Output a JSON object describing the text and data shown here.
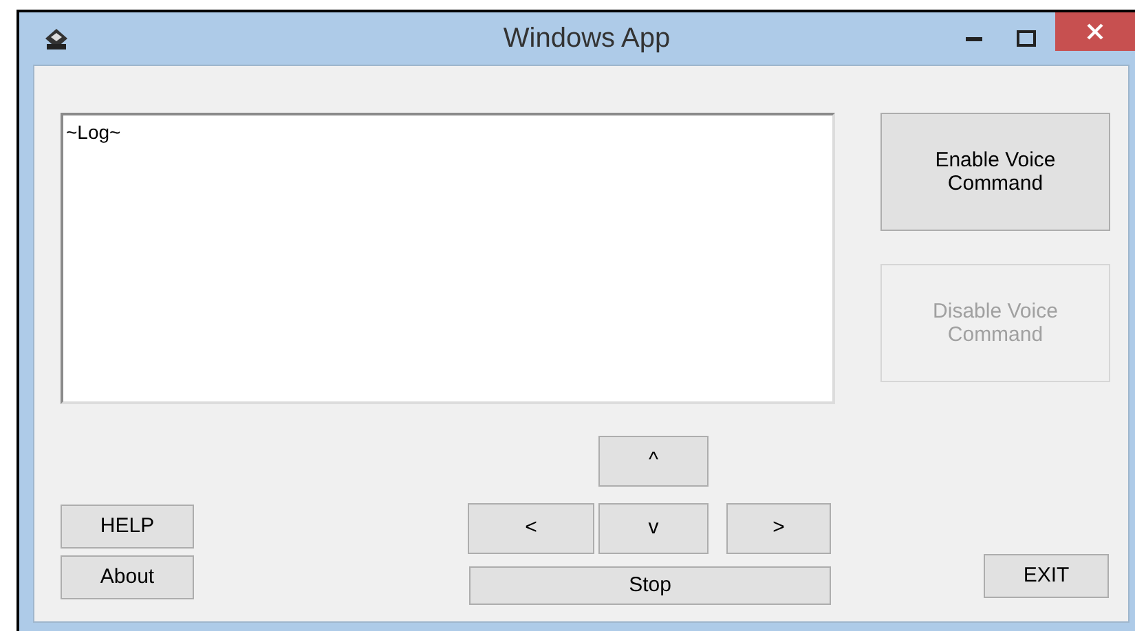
{
  "window": {
    "title": "Windows App"
  },
  "log": {
    "value": "~Log~"
  },
  "voice_buttons": [
    {
      "label": "Enable Voice Command",
      "disabled": false
    },
    {
      "label": "Disable Voice Command",
      "disabled": true
    }
  ],
  "help_buttons": [
    {
      "label": "HELP"
    },
    {
      "label": "About"
    }
  ],
  "direction_buttons": {
    "up": "^",
    "left": "<",
    "down": "v",
    "right": ">",
    "stop": "Stop"
  },
  "exit_button": {
    "label": "EXIT"
  }
}
